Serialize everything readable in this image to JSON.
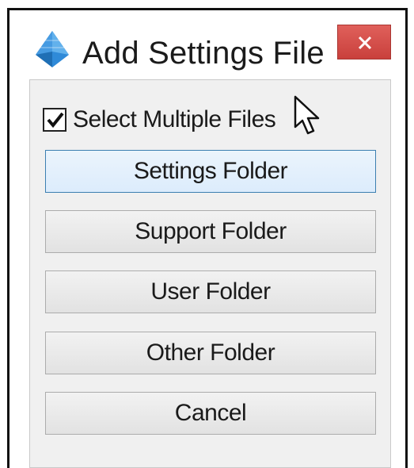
{
  "dialog": {
    "title": "Add Settings File",
    "close_glyph": "×",
    "icon": "pyramid-app-icon",
    "colors": {
      "close_button": "#d9534f",
      "hover_border": "#3c7fb1",
      "hover_fill": "#dcecfc",
      "client_background": "#f0f0f0",
      "app_icon_blue": "#1f78c8"
    }
  },
  "options": {
    "select_multiple_label": "Select Multiple Files",
    "select_multiple_checked": true
  },
  "buttons": {
    "settings_folder": "Settings Folder",
    "support_folder": "Support Folder",
    "user_folder": "User Folder",
    "other_folder": "Other Folder",
    "cancel": "Cancel"
  },
  "pointer": {
    "icon": "arrow-cursor-icon",
    "hovered_button": "Settings Folder"
  }
}
